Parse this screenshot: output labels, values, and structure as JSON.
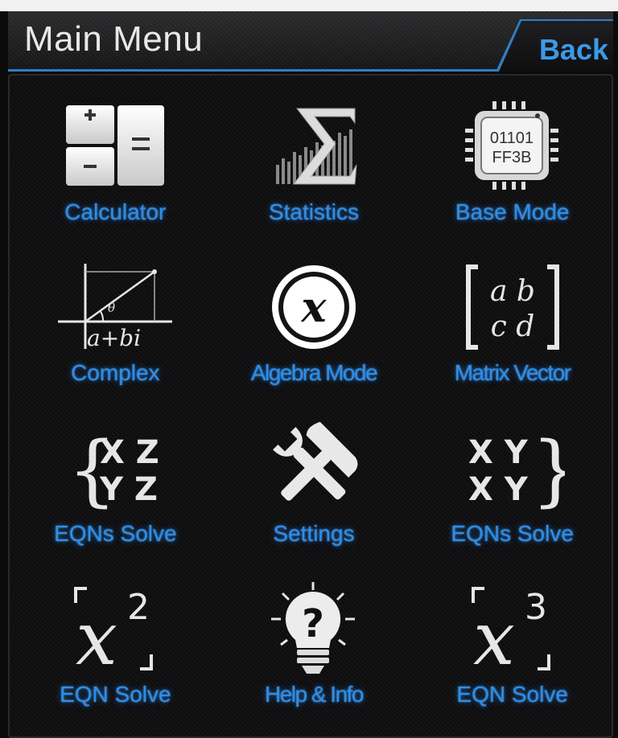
{
  "header": {
    "title": "Main Menu",
    "back_label": "Back"
  },
  "menu": [
    {
      "label": "Calculator",
      "icon": "calculator-icon"
    },
    {
      "label": "Statistics",
      "icon": "sigma-chart-icon"
    },
    {
      "label": "Base Mode",
      "icon": "chip-icon",
      "chip_text_1": "01101",
      "chip_text_2": "FF3B"
    },
    {
      "label": "Complex",
      "icon": "complex-plane-icon",
      "symbol_theta": "θ",
      "symbol_expr": "a+bi"
    },
    {
      "label": "Algebra Mode",
      "icon": "x-variable-icon",
      "symbol": "x"
    },
    {
      "label": "Matrix Vector",
      "icon": "matrix-icon",
      "row_1": "a b",
      "row_2": "c d"
    },
    {
      "label": "EQNs Solve",
      "icon": "equation-system-left-icon",
      "row_1": "X Z",
      "row_2": "Y Z"
    },
    {
      "label": "Settings",
      "icon": "tools-icon"
    },
    {
      "label": "EQNs Solve",
      "icon": "equation-system-right-icon",
      "row_1": "X Y",
      "row_2": "X Y"
    },
    {
      "label": "EQN Solve",
      "icon": "x-squared-icon",
      "base": "x",
      "exponent": "2"
    },
    {
      "label": "Help & Info",
      "icon": "help-bulb-icon",
      "symbol": "?"
    },
    {
      "label": "EQN Solve",
      "icon": "x-cubed-icon",
      "base": "x",
      "exponent": "3"
    }
  ],
  "colors": {
    "accent": "#2f8ee6",
    "header_border": "#2f7fc4",
    "background": "#0b0b0c"
  }
}
